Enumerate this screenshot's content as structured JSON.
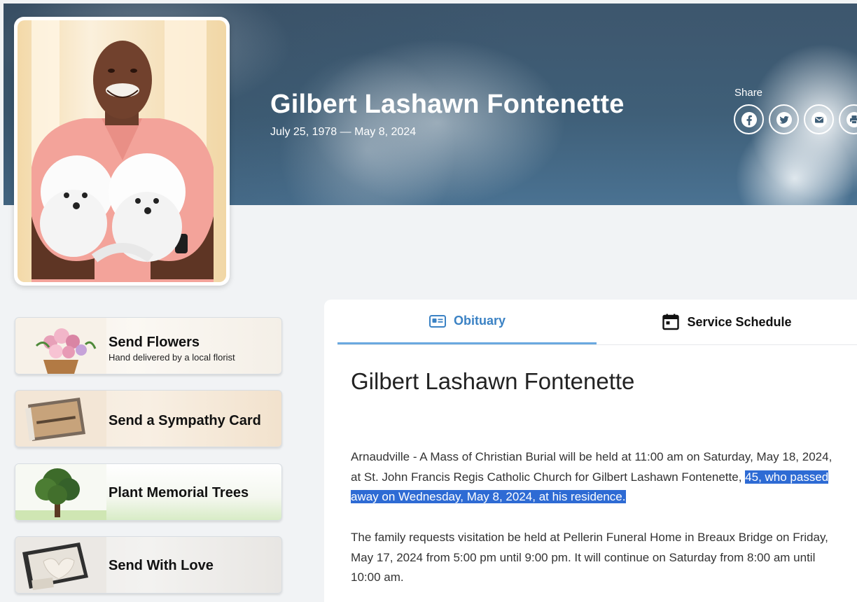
{
  "hero": {
    "name": "Gilbert Lashawn Fontenette",
    "dates": "July 25, 1978 — May 8, 2024",
    "share_label": "Share",
    "share_buttons": [
      "facebook-icon",
      "twitter-icon",
      "email-icon",
      "print-icon"
    ]
  },
  "sidebar": {
    "flowers": {
      "title": "Send Flowers",
      "subtitle": "Hand delivered by a local florist"
    },
    "card": {
      "title": "Send a Sympathy Card"
    },
    "trees": {
      "title": "Plant Memorial Trees"
    },
    "love": {
      "title": "Send With Love"
    }
  },
  "tabs": {
    "obituary": "Obituary",
    "schedule": "Service Schedule",
    "active": "Obituary"
  },
  "content": {
    "title": "Gilbert Lashawn Fontenette",
    "para1_before": "Arnaudville - A Mass of Christian Burial will be held at 11:00 am on Saturday, May 18, 2024, at St. John Francis Regis Catholic Church for Gilbert Lashawn Fontenette, ",
    "para1_selected": "45, who passed away on Wednesday, May 8, 2024, at his residence.",
    "para2": "The family requests visitation be held at Pellerin Funeral Home in Breaux Bridge on Friday, May 17, 2024 from 5:00 pm until 9:00 pm. It will continue on Saturday from 8:00 am until 10:00 am."
  },
  "colors": {
    "accent": "#3b82c4",
    "selection": "#2e6bd4",
    "hero_sky": "#3f5f78"
  }
}
